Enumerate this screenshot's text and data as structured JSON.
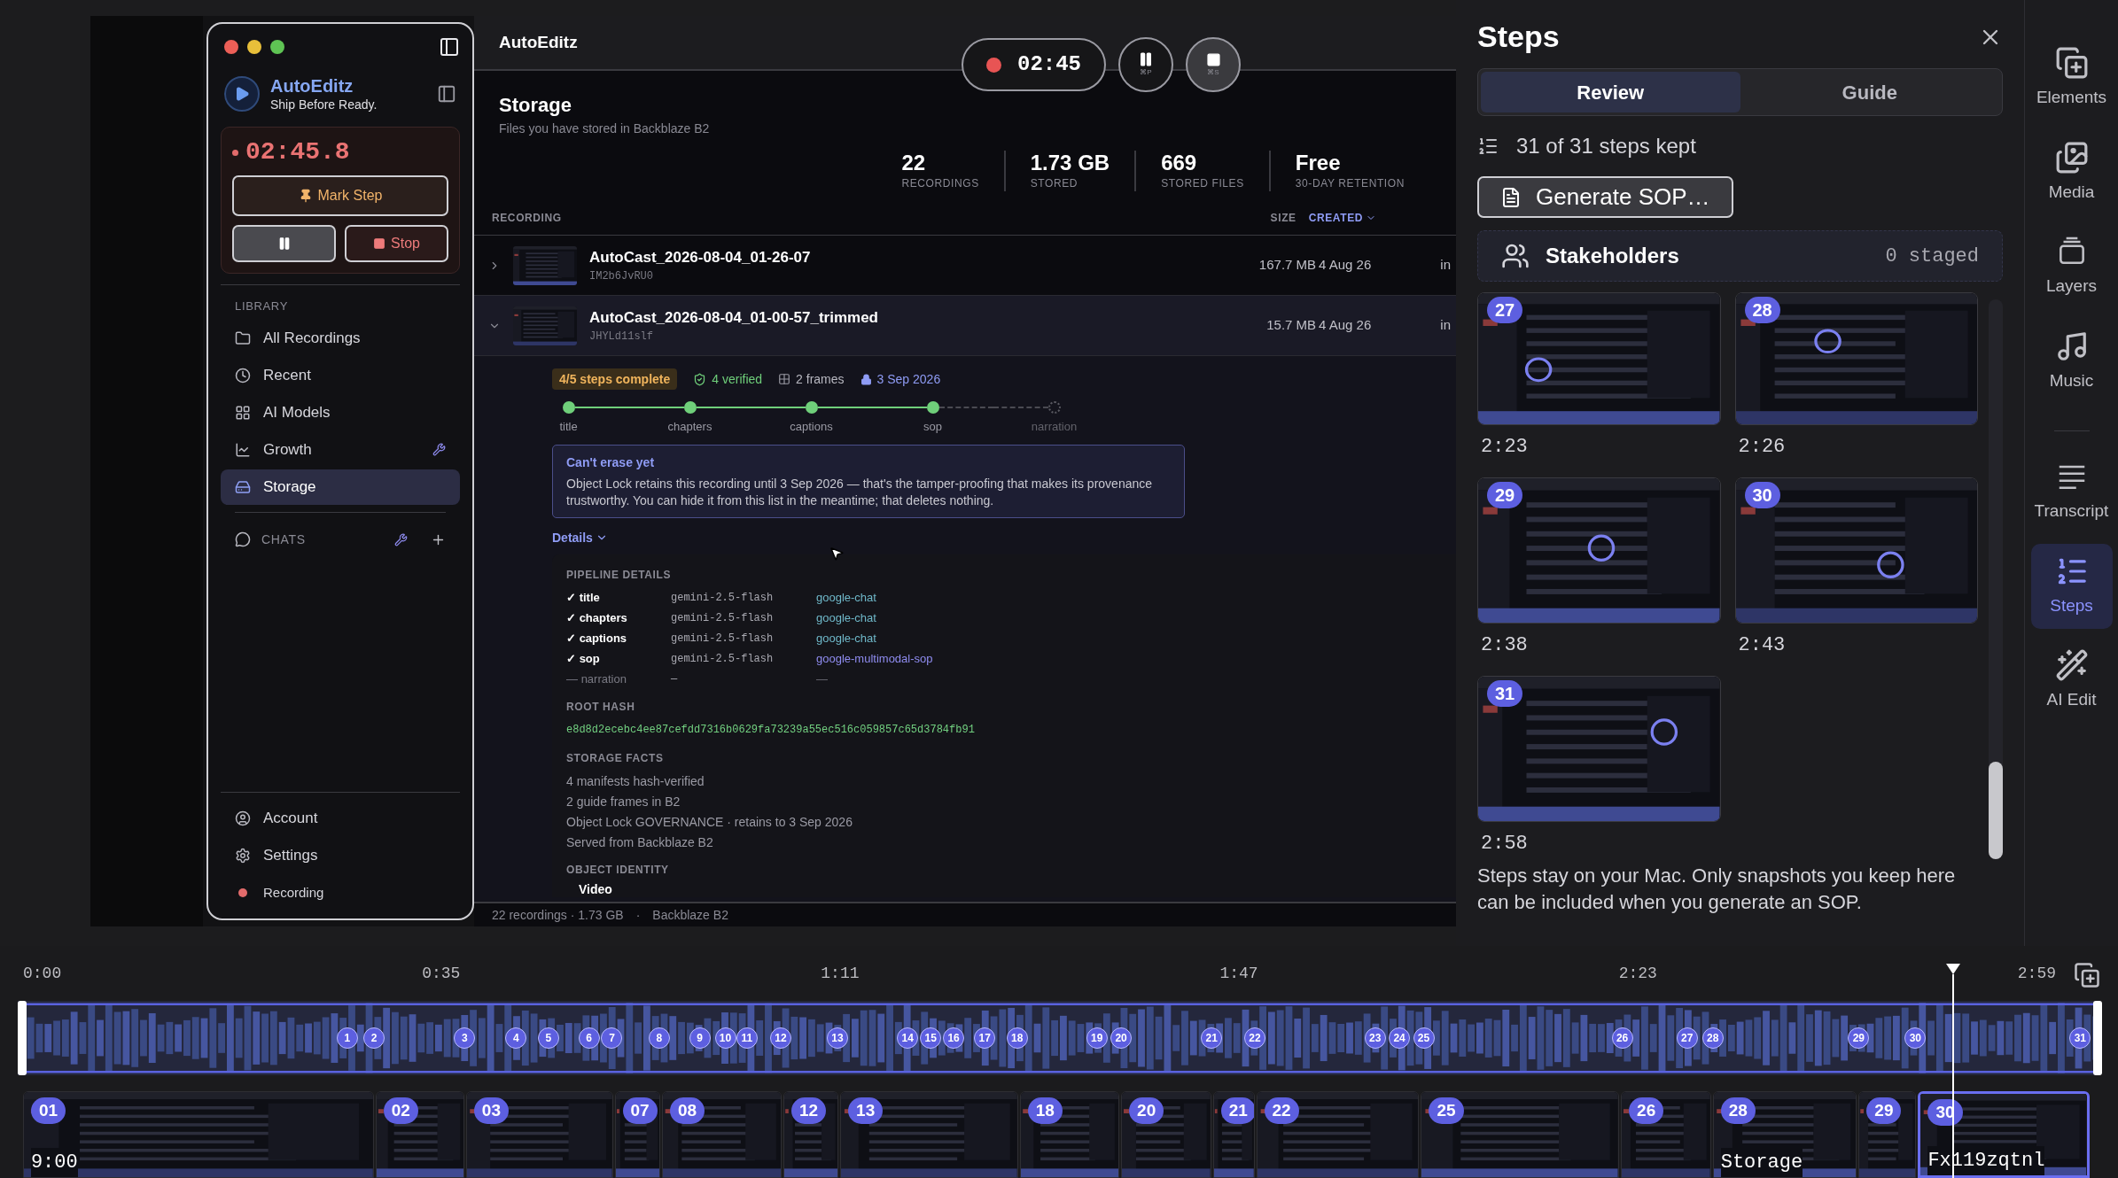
{
  "preview": {
    "sidebar": {
      "brand": "AutoEditz",
      "tagline": "Ship Before Ready.",
      "timer": "02:45.8",
      "mark_step": "Mark Step",
      "stop": "Stop",
      "library_heading": "LIBRARY",
      "items": [
        {
          "label": "All Recordings",
          "selected": false,
          "tools": false
        },
        {
          "label": "Recent",
          "selected": false,
          "tools": false
        },
        {
          "label": "AI Models",
          "selected": false,
          "tools": false
        },
        {
          "label": "Growth",
          "selected": false,
          "tools": true
        },
        {
          "label": "Storage",
          "selected": true,
          "tools": false
        }
      ],
      "chats_heading": "CHATS",
      "footer": [
        {
          "label": "Account",
          "kind": "account"
        },
        {
          "label": "Settings",
          "kind": "settings"
        },
        {
          "label": "Recording",
          "kind": "status"
        }
      ]
    },
    "header": {
      "title": "AutoEditz"
    },
    "recorder": {
      "time": "02:45",
      "pause_shortcut": "⌘P",
      "stop_shortcut": "⌘S"
    },
    "page": {
      "title": "Storage",
      "subtitle": "Files you have stored in Backblaze B2"
    },
    "stats": [
      {
        "value": "22",
        "label": "RECORDINGS"
      },
      {
        "value": "1.73 GB",
        "label": "STORED"
      },
      {
        "value": "669",
        "label": "STORED FILES"
      },
      {
        "value": "Free",
        "label": "30-DAY RETENTION"
      }
    ],
    "table": {
      "columns": [
        {
          "label": "RECORDING",
          "sorted": false
        },
        {
          "label": "SIZE",
          "sorted": false
        },
        {
          "label": "CREATED",
          "sorted": true
        }
      ],
      "rows": [
        {
          "name": "AutoCast_2026-08-04_01-26-07",
          "id": "IM2b6JvRU0",
          "size": "167.7 MB",
          "created": "4 Aug 26",
          "column_3": "in",
          "expanded": false
        },
        {
          "name": "AutoCast_2026-08-04_01-00-57_trimmed",
          "id": "JHYLd11slf",
          "size": "15.7 MB",
          "created": "4 Aug 26",
          "column_3": "in",
          "expanded": true
        }
      ]
    },
    "details": {
      "steps_badge": "4/5 steps complete",
      "verified": "4 verified",
      "frames": "2 frames",
      "retention": "3 Sep 2026",
      "pipeline": [
        {
          "label": "title",
          "done": true
        },
        {
          "label": "chapters",
          "done": true
        },
        {
          "label": "captions",
          "done": true
        },
        {
          "label": "sop",
          "done": true
        },
        {
          "label": "narration",
          "done": false
        }
      ],
      "notice": {
        "title": "Can't erase yet",
        "body": "Object Lock retains this recording until 3 Sep 2026 — that's the tamper-proofing that makes its provenance trustworthy. You can hide it from this list in the meantime; that deletes nothing."
      },
      "toggle": "Details",
      "pipeline_heading": "PIPELINE DETAILS",
      "pipeline_rows": [
        {
          "mark": "✓",
          "step": "title",
          "model": "gemini-2.5-flash",
          "provider": "google-chat",
          "done": true,
          "color": "#6fb8c9"
        },
        {
          "mark": "✓",
          "step": "chapters",
          "model": "gemini-2.5-flash",
          "provider": "google-chat",
          "done": true,
          "color": "#6fb8c9"
        },
        {
          "mark": "✓",
          "step": "captions",
          "model": "gemini-2.5-flash",
          "provider": "google-chat",
          "done": true,
          "color": "#6fb8c9"
        },
        {
          "mark": "✓",
          "step": "sop",
          "model": "gemini-2.5-flash",
          "provider": "google-multimodal-sop",
          "done": true,
          "color": "#8f8cf0"
        },
        {
          "mark": "—",
          "step": "narration",
          "model": "—",
          "provider": "—",
          "done": false,
          "color": "#6b6b75"
        }
      ],
      "hash_heading": "ROOT HASH",
      "hash": "e8d8d2ecebc4ee87cefdd7316b0629fa73239a55ec516c059857c65d3784fb91",
      "facts_heading": "STORAGE FACTS",
      "facts": [
        "4 manifests hash-verified",
        "2 guide frames in B2",
        "Object Lock GOVERNANCE · retains to 3 Sep 2026",
        "Served from Backblaze B2"
      ],
      "identity_heading": "OBJECT IDENTITY",
      "identity_first": "Video"
    },
    "status_bar": {
      "summary": "22 recordings · 1.73 GB",
      "separator": "·",
      "storage": "Backblaze B2"
    }
  },
  "steps_panel": {
    "title": "Steps",
    "tabs": [
      {
        "label": "Review",
        "selected": true
      },
      {
        "label": "Guide",
        "selected": false
      }
    ],
    "count": "31 of 31 steps kept",
    "generate": "Generate SOP…",
    "stakeholders": {
      "label": "Stakeholders",
      "staged": "0 staged"
    },
    "snapshots": [
      {
        "number": "27",
        "time": "2:23"
      },
      {
        "number": "28",
        "time": "2:26"
      },
      {
        "number": "29",
        "time": "2:38"
      },
      {
        "number": "30",
        "time": "2:43"
      },
      {
        "number": "31",
        "time": "2:58"
      }
    ],
    "note": "Steps stay on your Mac. Only snapshots you keep here can be included when you generate an SOP."
  },
  "rail": [
    {
      "label": "Elements",
      "selected": false
    },
    {
      "label": "Media",
      "selected": false
    },
    {
      "label": "Layers",
      "selected": false
    },
    {
      "label": "Music",
      "selected": false
    },
    {
      "label": "Transcript",
      "selected": false
    },
    {
      "label": "Steps",
      "selected": true
    },
    {
      "label": "AI Edit",
      "selected": false
    }
  ],
  "timeline": {
    "ticks": [
      "0:00",
      "0:35",
      "1:11",
      "1:47",
      "2:23",
      "2:59"
    ],
    "markers": [
      "1",
      "2",
      "3",
      "4",
      "5",
      "6",
      "7",
      "8",
      "9",
      "10",
      "11",
      "12",
      "13",
      "14",
      "15",
      "16",
      "17",
      "18",
      "19",
      "20",
      "21",
      "22",
      "23",
      "24",
      "25",
      "26",
      "27",
      "28",
      "29",
      "30",
      "31"
    ],
    "clips": [
      {
        "number": "01",
        "caption": "9:00",
        "selected": false
      },
      {
        "number": "02",
        "selected": false
      },
      {
        "number": "03",
        "selected": false
      },
      {
        "number": "07",
        "selected": false
      },
      {
        "number": "08",
        "selected": false
      },
      {
        "number": "12",
        "selected": false
      },
      {
        "number": "13",
        "selected": false
      },
      {
        "number": "18",
        "selected": false
      },
      {
        "number": "20",
        "selected": false
      },
      {
        "number": "21",
        "selected": false
      },
      {
        "number": "22",
        "selected": false
      },
      {
        "number": "25",
        "selected": false
      },
      {
        "number": "26",
        "selected": false
      },
      {
        "number": "28",
        "caption": "Storage",
        "selected": false
      },
      {
        "number": "29",
        "selected": false
      },
      {
        "number": "30",
        "caption": "Fx119zqtnl",
        "selected": true
      }
    ]
  }
}
